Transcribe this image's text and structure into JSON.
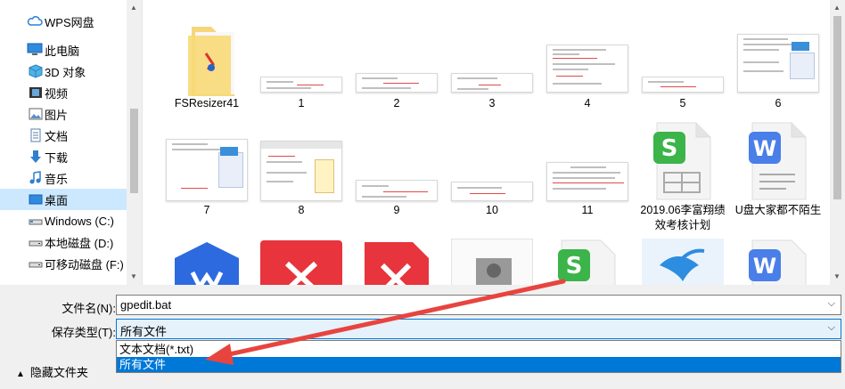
{
  "nav": {
    "items": [
      {
        "label": "WPS网盘",
        "icon": "cloud-icon"
      },
      {
        "label": "此电脑",
        "icon": "computer-icon"
      },
      {
        "label": "3D 对象",
        "icon": "3d-objects-icon"
      },
      {
        "label": "视频",
        "icon": "video-icon"
      },
      {
        "label": "图片",
        "icon": "pictures-icon"
      },
      {
        "label": "文档",
        "icon": "documents-icon"
      },
      {
        "label": "下载",
        "icon": "download-icon"
      },
      {
        "label": "音乐",
        "icon": "music-icon"
      },
      {
        "label": "桌面",
        "icon": "desktop-icon",
        "selected": true
      },
      {
        "label": "Windows (C:)",
        "icon": "drive-icon"
      },
      {
        "label": "本地磁盘 (D:)",
        "icon": "drive-icon"
      },
      {
        "label": "可移动磁盘 (F:)",
        "icon": "removable-drive-icon"
      }
    ]
  },
  "files": {
    "row1": [
      "FSResizer41",
      "1",
      "2",
      "3",
      "4",
      "5",
      "6"
    ],
    "row2": [
      "7",
      "8",
      "9",
      "10",
      "11",
      "2019.06李富翔绩效考核计划",
      "U盘大家都不陌生"
    ]
  },
  "form": {
    "filename_label": "文件名(N):",
    "filename_value": "gpedit.bat",
    "filetype_label": "保存类型(T):",
    "filetype_value": "所有文件",
    "options": [
      "文本文档(*.txt)",
      "所有文件"
    ],
    "hide_folders": "隐藏文件夹"
  },
  "colors": {
    "selection": "#cce8ff",
    "highlight": "#0078d7",
    "wps_sheet": "#3bb44a",
    "wps_word": "#4a7ee8",
    "wps_red": "#e8343d",
    "annotation_arrow": "#e8443f"
  }
}
